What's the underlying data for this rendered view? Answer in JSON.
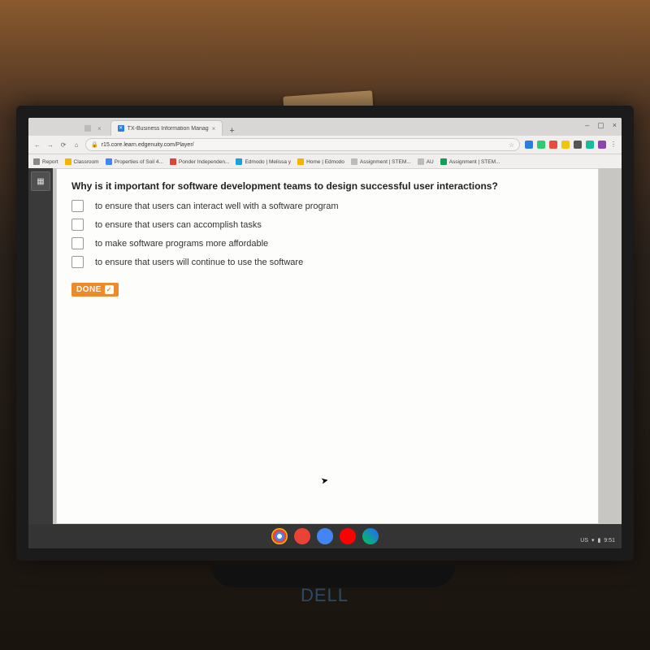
{
  "browser": {
    "tabs": [
      {
        "title": "",
        "favicon": "#bbbbbb",
        "active": false
      },
      {
        "title": "TX-Business Information Manag",
        "favicon": "#2a7de1",
        "active": true
      }
    ],
    "url": "r15.core.learn.edgenuity.com/Player/",
    "window_controls": {
      "min": "–",
      "max": "▢",
      "close": "×"
    }
  },
  "addressbar_icons": {
    "star_color": "#d0cfcd",
    "ext1": "#2a7de1",
    "ext2": "#2ecc71",
    "ext3": "#e74c3c",
    "ext4": "#f1c40f",
    "ext5": "#555555",
    "ext6": "#1abc9c",
    "ext7": "#8e44ad"
  },
  "bookmarks": [
    {
      "label": "Report",
      "color": "#888888"
    },
    {
      "label": "Classroom",
      "color": "#f4b400"
    },
    {
      "label": "Properties of Soil 4...",
      "color": "#4285f4"
    },
    {
      "label": "Ponder Independen...",
      "color": "#db4437"
    },
    {
      "label": "Edmodo | Melissa y",
      "color": "#1ca0d8"
    },
    {
      "label": "Home | Edmodo",
      "color": "#f4b400"
    },
    {
      "label": "Assignment | STEM...",
      "color": "#bbbbbb"
    },
    {
      "label": "AU",
      "color": "#bbbbbb"
    },
    {
      "label": "Assignment | STEM...",
      "color": "#0f9d58"
    }
  ],
  "quiz": {
    "question": "Why is it important for software development teams to design successful user interactions?",
    "options": [
      "to ensure that users can interact well with a software program",
      "to ensure that users can accomplish tasks",
      "to make software programs more affordable",
      "to ensure that users will continue to use the software"
    ],
    "done_label": "DONE"
  },
  "shelf": {
    "apps": [
      {
        "name": "chrome",
        "bg": "radial-gradient(circle at 50% 50%,#fff 20%,#4285f4 21% 40%,#ea4335 41% 60%,#fbbc05 61% 80%,#34a853 81%)"
      },
      {
        "name": "gmail",
        "bg": "linear-gradient(#ea4335,#ea4335)"
      },
      {
        "name": "docs",
        "bg": "linear-gradient(#4285f4,#4285f4)"
      },
      {
        "name": "youtube",
        "bg": "linear-gradient(#ff0000,#ff0000)"
      },
      {
        "name": "play",
        "bg": "linear-gradient(45deg,#00c853,#2962ff)"
      }
    ],
    "status": {
      "lang": "US",
      "wifi": "▾",
      "battery": "▮",
      "time": "9:51"
    }
  },
  "laptop_brand": "DELL"
}
